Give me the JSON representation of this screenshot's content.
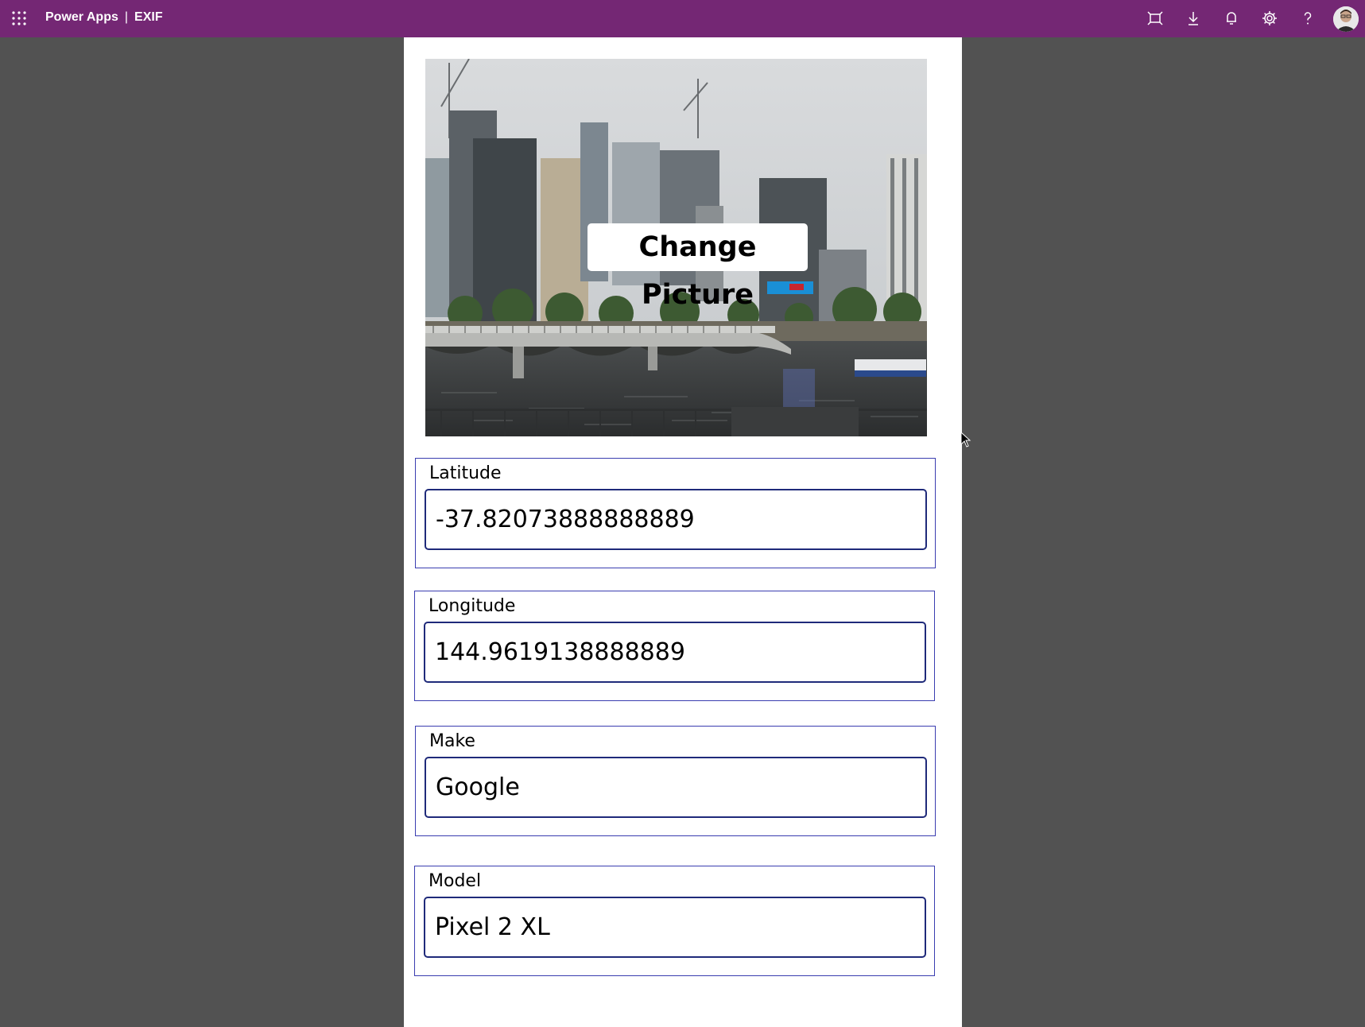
{
  "header": {
    "app_name": "Power Apps",
    "separator": "|",
    "screen_name": "EXIF",
    "brand_color": "#742774",
    "icons": [
      "waffle-icon",
      "fit-to-window-icon",
      "download-icon",
      "notification-bell-icon",
      "settings-gear-icon",
      "help-icon",
      "user-avatar"
    ]
  },
  "photo": {
    "button_label": "Change Picture"
  },
  "fields": [
    {
      "label": "Latitude",
      "value": "-37.82073888888889"
    },
    {
      "label": "Longitude",
      "value": "144.9619138888889"
    },
    {
      "label": "Make",
      "value": "Google"
    },
    {
      "label": "Model",
      "value": "Pixel 2 XL"
    }
  ]
}
